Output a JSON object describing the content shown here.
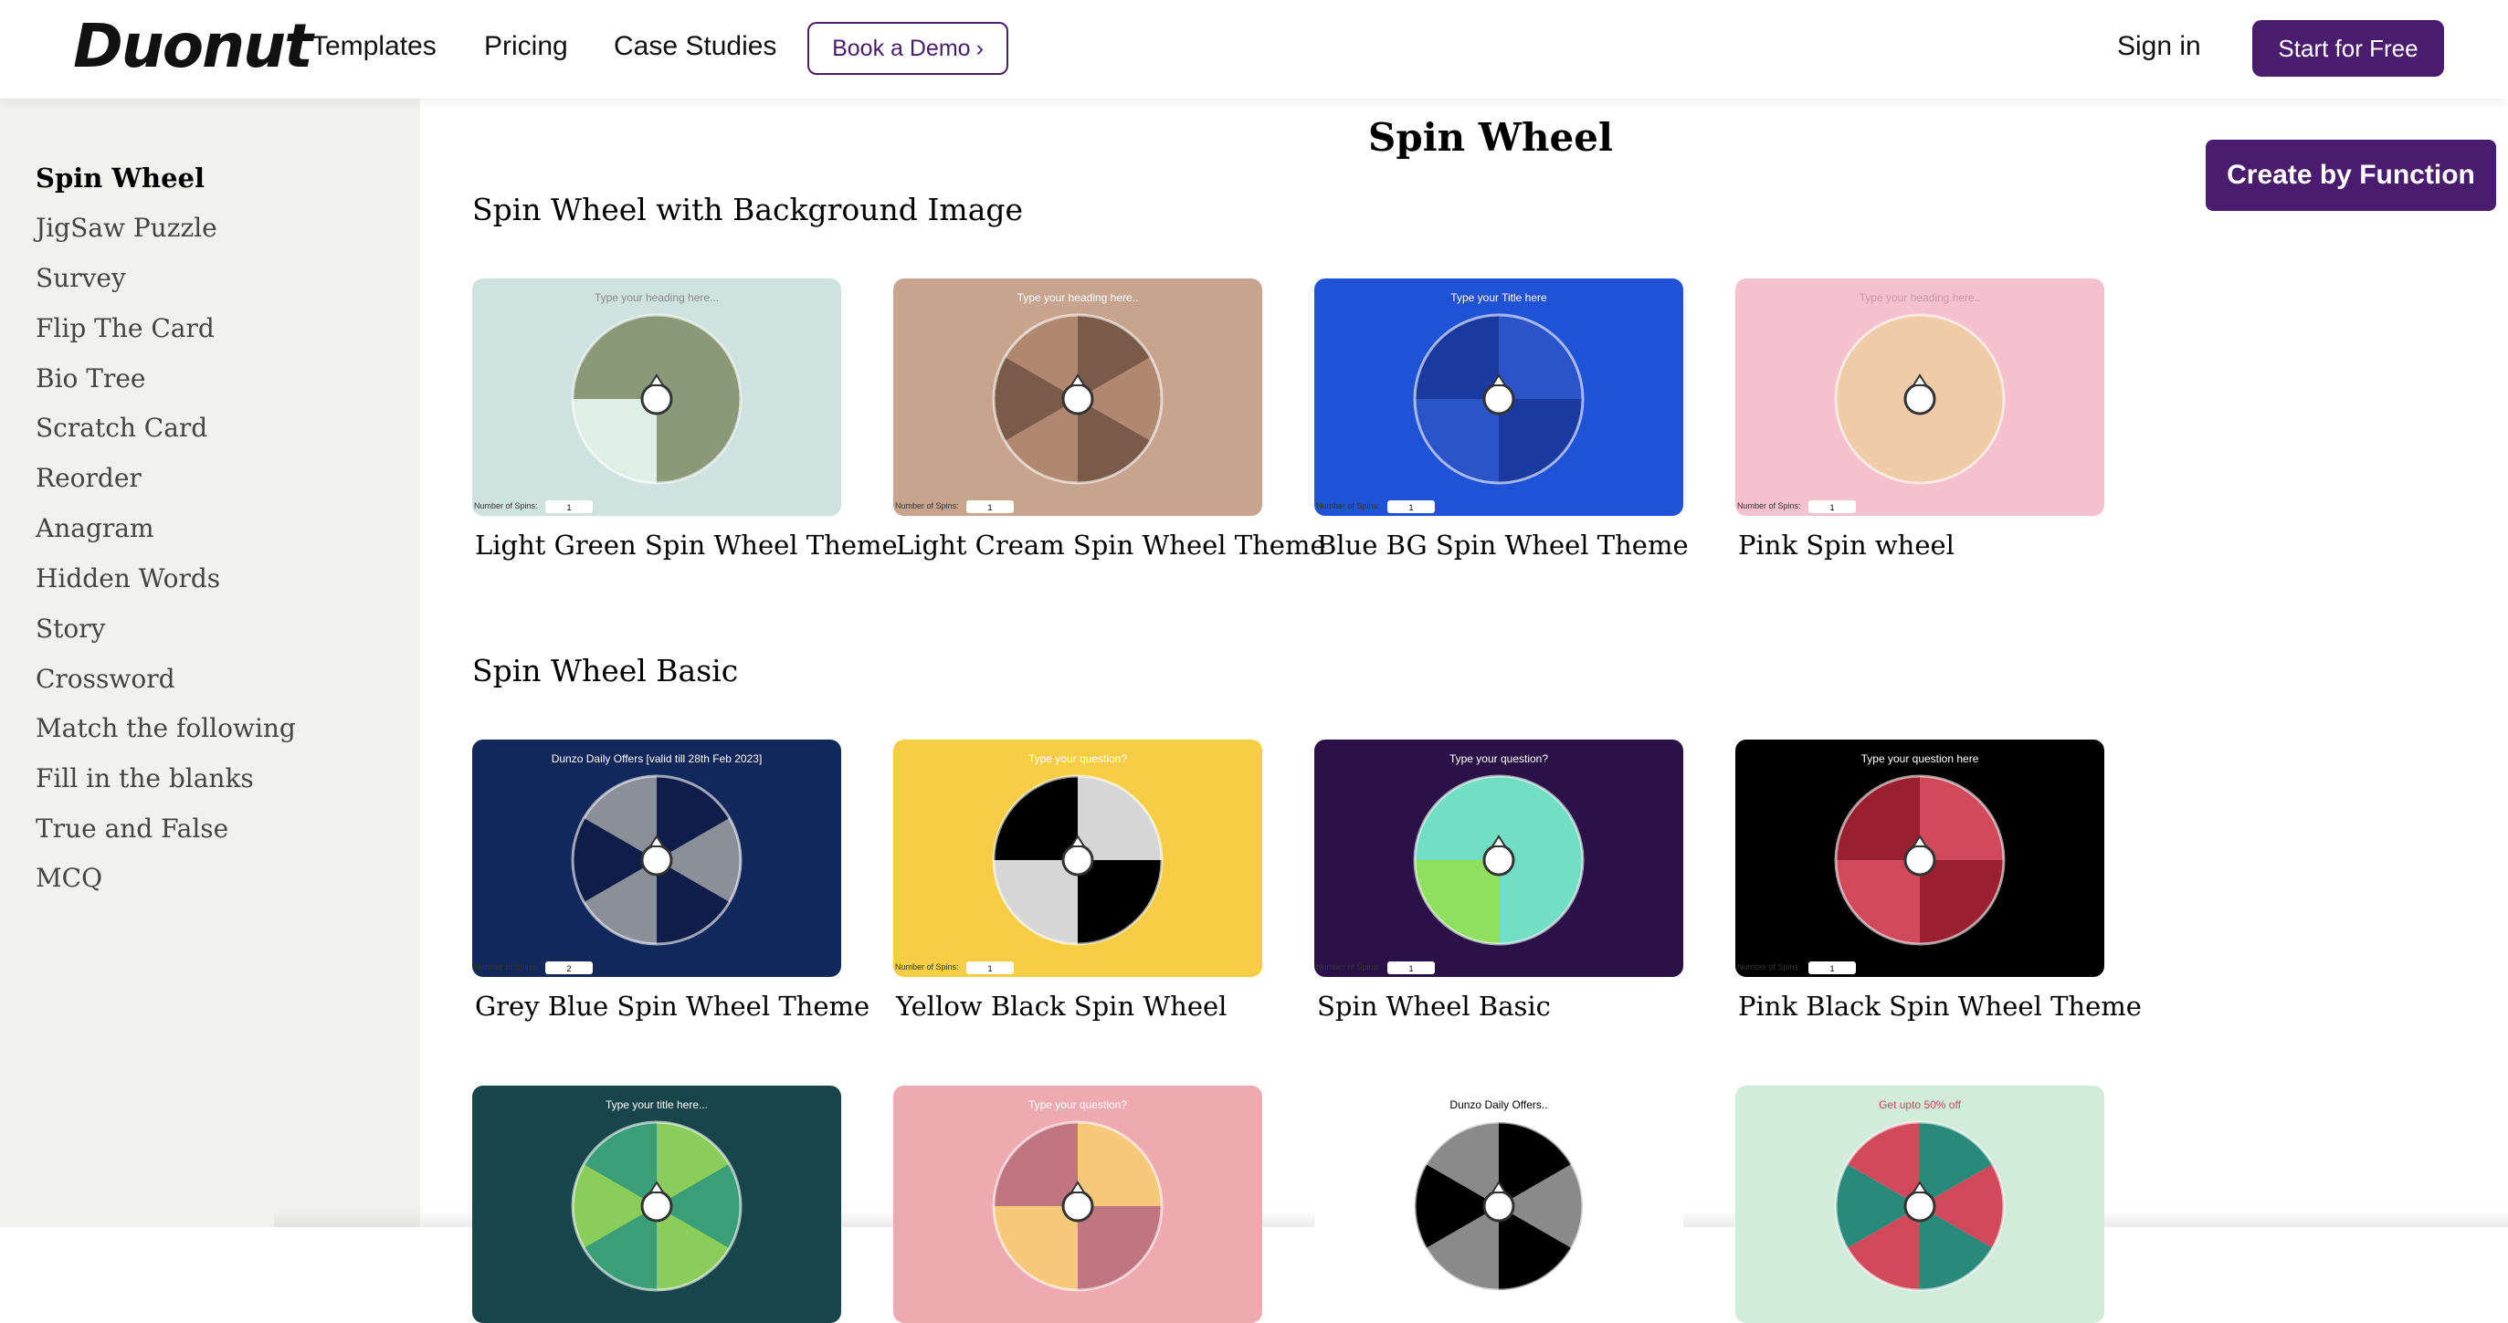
{
  "header": {
    "logo": "Duonut",
    "nav": [
      "Templates",
      "Pricing",
      "Case Studies"
    ],
    "demo_label": "Book a Demo",
    "demo_chevron": "›",
    "signin_label": "Sign in",
    "start_label": "Start for Free"
  },
  "sidebar": {
    "items": [
      "Spin Wheel",
      "JigSaw Puzzle",
      "Survey",
      "Flip The Card",
      "Bio Tree",
      "Scratch Card",
      "Reorder",
      "Anagram",
      "Hidden Words",
      "Story",
      "Crossword",
      "Match the following",
      "Fill in the blanks",
      "True and False",
      "MCQ"
    ],
    "active": "Spin Wheel"
  },
  "main": {
    "title": "Spin Wheel",
    "create_label": "Create by Function",
    "sections": [
      {
        "title": "Spin Wheel with Background Image",
        "cards": [
          {
            "label": "Light Green Spin Wheel Theme",
            "heading": "Type your heading here...",
            "spins_label": "Number of Spins:",
            "spins": "1",
            "bg": "#cfe3de",
            "colors": [
              "#8a9a78",
              "#8a9a78",
              "#dfeee6",
              "#8a9a78"
            ],
            "text_color": "#8a8a8a"
          },
          {
            "label": "Light Cream Spin Wheel Theme",
            "heading": "Type your heading here..",
            "spins_label": "Number of Spins:",
            "spins": "1",
            "bg": "#c8a48f",
            "colors": [
              "#7a5a48",
              "#b08870",
              "#7a5a48",
              "#b08870",
              "#7a5a48",
              "#b08870"
            ],
            "text_color": "#ffffff"
          },
          {
            "label": "Blue BG Spin Wheel Theme",
            "heading": "Type your Title here",
            "spins_label": "Number of Spins:",
            "spins": "1",
            "bg": "#1f52d6",
            "colors": [
              "#2a54c8",
              "#1a3aa0",
              "#2a54c8",
              "#1a3aa0"
            ],
            "text_color": "#ffffff"
          },
          {
            "label": "Pink Spin wheel",
            "heading": "Type your heading here..",
            "spins_label": "Number of Spins:",
            "spins": "1",
            "bg": "#f4c2ce",
            "colors": [
              "#f0cba8",
              "#f0cba8",
              "#f0cba8",
              "#f0cba8",
              "#f0cba8",
              "#f0cba8"
            ],
            "text_color": "#c89aa4"
          }
        ]
      },
      {
        "title": "Spin Wheel Basic",
        "cards": [
          {
            "label": "Grey Blue Spin Wheel Theme",
            "heading": "Dunzo Daily Offers [valid till 28th Feb 2023]",
            "spins_label": "Number of Spins:",
            "spins": "2",
            "bg": "#12275a",
            "colors": [
              "#0f1e48",
              "#8a8f9a",
              "#0f1e48",
              "#8a8f9a",
              "#0f1e48",
              "#8a8f9a"
            ],
            "text_color": "#ffffff"
          },
          {
            "label": "Yellow Black Spin Wheel",
            "heading": "Type your question?",
            "spins_label": "Number of Spins:",
            "spins": "1",
            "bg": "#f6cd45",
            "colors": [
              "#d6d6d6",
              "#000000",
              "#d6d6d6",
              "#000000"
            ],
            "text_color": "#ffffff"
          },
          {
            "label": "Spin Wheel Basic",
            "heading": "Type your question?",
            "spins_label": "Number of Spins:",
            "spins": "1",
            "bg": "#2a1248",
            "colors": [
              "#72dfc4",
              "#72dfc4",
              "#8fe060",
              "#72dfc4"
            ],
            "text_color": "#ffffff"
          },
          {
            "label": "Pink Black Spin Wheel Theme",
            "heading": "Type your question here",
            "spins_label": "Number of Spins:",
            "spins": "1",
            "bg": "#000000",
            "colors": [
              "#d04a5c",
              "#9a2030",
              "#d04a5c",
              "#9a2030"
            ],
            "text_color": "#ffffff"
          }
        ]
      },
      {
        "title": "",
        "cards": [
          {
            "label": "",
            "heading": "Type your title here...",
            "spins_label": "",
            "spins": "",
            "bg": "#17454a",
            "colors": [
              "#8acd5a",
              "#3a9e78",
              "#8acd5a",
              "#3a9e78",
              "#8acd5a",
              "#3a9e78"
            ],
            "text_color": "#ffffff"
          },
          {
            "label": "",
            "heading": "Type your question?",
            "spins_label": "",
            "spins": "",
            "bg": "#eeaab0",
            "colors": [
              "#f6c87a",
              "#c07680",
              "#f6c87a",
              "#c07680"
            ],
            "text_color": "#ffffff"
          },
          {
            "label": "",
            "heading": "Dunzo Daily Offers..",
            "spins_label": "",
            "spins": "",
            "bg": "#ffffff",
            "colors": [
              "#000000",
              "#8a8a8a",
              "#000000",
              "#8a8a8a",
              "#000000",
              "#8a8a8a"
            ],
            "text_color": "#000000"
          },
          {
            "label": "",
            "heading": "Get upto 50% off",
            "spins_label": "",
            "spins": "",
            "bg": "#d2ecda",
            "colors": [
              "#2a8a7a",
              "#d04a5c",
              "#2a8a7a",
              "#d04a5c",
              "#2a8a7a",
              "#d04a5c"
            ],
            "text_color": "#d04a5c"
          }
        ]
      }
    ]
  }
}
